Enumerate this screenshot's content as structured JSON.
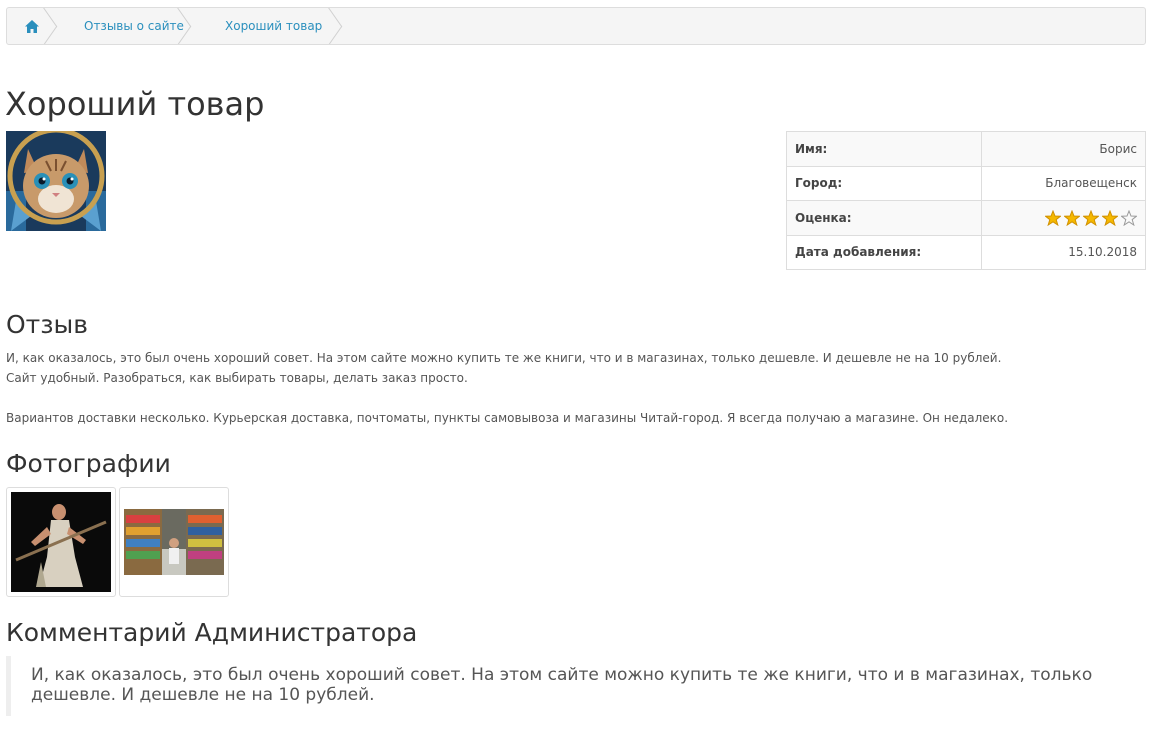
{
  "breadcrumb": {
    "home_icon": "home-icon",
    "items": [
      "Отзывы о сайте",
      "Хороший товар"
    ]
  },
  "title": "Хороший товар",
  "info": {
    "rows": [
      {
        "label": "Имя:",
        "value": "Борис"
      },
      {
        "label": "Город:",
        "value": "Благовещенск"
      },
      {
        "label": "Оценка:",
        "rating": 4,
        "rating_max": 5
      },
      {
        "label": "Дата добавления:",
        "value": "15.10.2018"
      }
    ],
    "star_color": "#f5b800"
  },
  "review": {
    "heading": "Отзыв",
    "paragraph1": "И, как оказалось, это был очень хороший совет. На этом сайте можно купить те же книги, что и в магазинах, только дешевле. И дешевле не на 10 рублей.\nСайт удобный. Разобраться, как выбирать товары, делать заказ просто.",
    "paragraph2": "Вариантов доставки несколько. Курьерская доставка, почтоматы, пункты самовывоза и магазины Читай-город. Я всегда получаю а магазине. Он недалеко."
  },
  "photos": {
    "heading": "Фотографии"
  },
  "admin": {
    "heading": "Комментарий Администратора",
    "comment": "И, как оказалось, это был очень хороший совет. На этом сайте можно купить те же книги, что и в магазинах, только дешевле. И дешевле не на 10 рублей."
  },
  "colors": {
    "link": "#2a8fbd",
    "text": "#333333"
  }
}
